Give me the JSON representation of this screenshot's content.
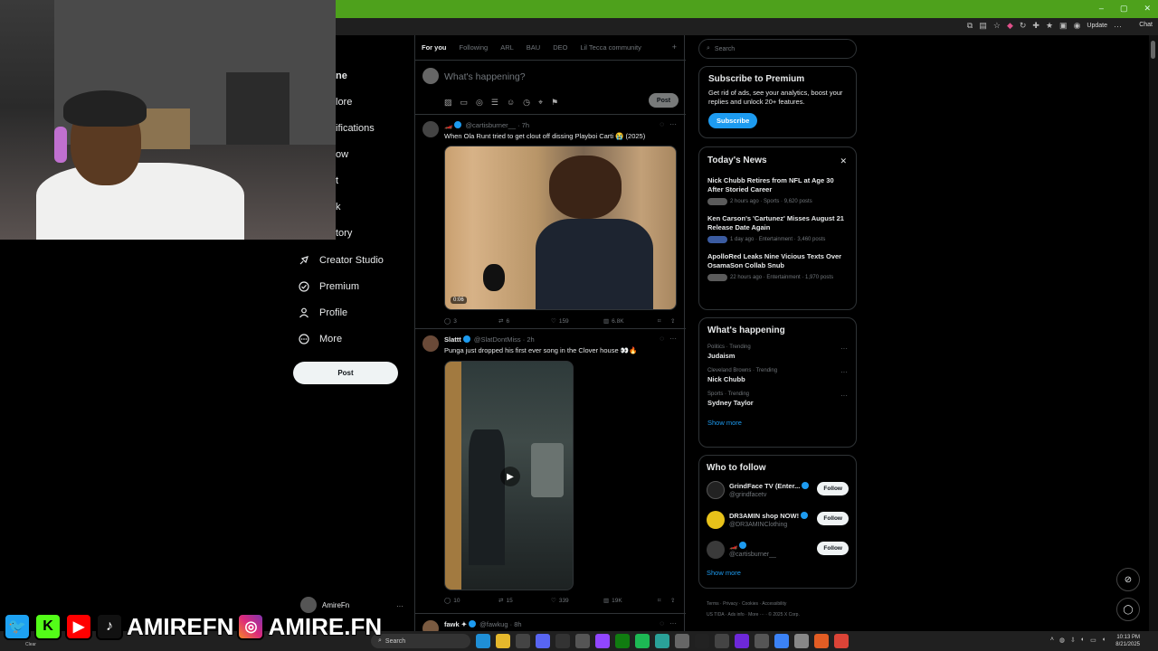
{
  "browser": {
    "window_controls": [
      "–",
      "▢",
      "✕"
    ],
    "update_label": "Update",
    "chat_label": "Chat"
  },
  "sidebar": {
    "partial_items": [
      "ne",
      "lore",
      "ifications",
      "ow",
      "t",
      "k",
      "tory"
    ],
    "items": [
      {
        "label": "Creator Studio",
        "icon": "rocket-icon"
      },
      {
        "label": "Premium",
        "icon": "premium-icon"
      },
      {
        "label": "Profile",
        "icon": "profile-icon"
      },
      {
        "label": "More",
        "icon": "more-circle-icon"
      }
    ],
    "post_label": "Post",
    "account_name": "AmireFn",
    "account_dots": "···"
  },
  "feed": {
    "tabs": [
      "For you",
      "Following",
      "ARL",
      "BAU",
      "DEO",
      "Lil Tecca community"
    ],
    "tab_plus": "+",
    "composer_placeholder": "What's happening?",
    "composer_post": "Post",
    "tweets": [
      {
        "name": "🏎️",
        "handle": "@cartisburner__",
        "time": "· 7h",
        "text": "When Ola Runt tried to get clout off dissing Playboi Carti 😭 (2025)",
        "duration": "0:06",
        "replies": "3",
        "reposts": "6",
        "likes": "159",
        "views": "6.8K"
      },
      {
        "name": "Slattt",
        "handle": "@SlatDontMiss",
        "time": "· 2h",
        "text": "Punga just dropped his first ever song in the Clover house 👀🔥",
        "replies": "10",
        "reposts": "15",
        "likes": "339",
        "views": "19K"
      },
      {
        "name": "fawk ✦",
        "handle": "@fawkug",
        "time": "· 8h"
      }
    ]
  },
  "right": {
    "search_placeholder": "Search",
    "premium": {
      "title": "Subscribe to Premium",
      "desc": "Get rid of ads, see your analytics, boost your replies and unlock 20+ features.",
      "button": "Subscribe"
    },
    "news": {
      "title": "Today's News",
      "items": [
        {
          "title": "Nick Chubb Retires from NFL at Age 30 After Storied Career",
          "meta": "2 hours ago · Sports · 9,620 posts"
        },
        {
          "title": "Ken Carson's 'Cartunez' Misses August 21 Release Date Again",
          "meta": "1 day ago · Entertainment · 3,460 posts"
        },
        {
          "title": "ApolloRed Leaks Nine Vicious Texts Over OsamaSon Collab Snub",
          "meta": "22 hours ago · Entertainment · 1,970 posts"
        }
      ]
    },
    "happening": {
      "title": "What's happening",
      "trends": [
        {
          "cat": "Politics · Trending",
          "name": "Judaism"
        },
        {
          "cat": "Cleveland Browns · Trending",
          "name": "Nick Chubb"
        },
        {
          "cat": "Sports · Trending",
          "name": "Sydney Taylor"
        }
      ],
      "show_more": "Show more"
    },
    "who_to_follow": {
      "title": "Who to follow",
      "accounts": [
        {
          "name": "GrindFace TV (Enter...",
          "handle": "@grindfacetv",
          "button": "Follow"
        },
        {
          "name": "DR3AMIN shop NOW!",
          "handle": "@DR3AMINClothing",
          "button": "Follow"
        },
        {
          "name": "🏎️",
          "handle": "@cartisburner__",
          "button": "Follow"
        }
      ],
      "show_more": "Show more"
    },
    "footer": [
      "Terms",
      "Privacy",
      "Cookies",
      "Accessibility",
      "US TIDA",
      "Ads info",
      "More ···",
      "© 2025 X Corp."
    ]
  },
  "taskbar": {
    "search": "Search",
    "time": "10:13 PM",
    "date": "8/21/2025",
    "weather": "Clear"
  },
  "overlay": {
    "handle_1": "AMIREFN",
    "handle_2": "AMIRE.FN"
  },
  "colors": {
    "accent": "#1d9bf0",
    "browser_green": "#4ea11c",
    "bg": "#000000"
  }
}
